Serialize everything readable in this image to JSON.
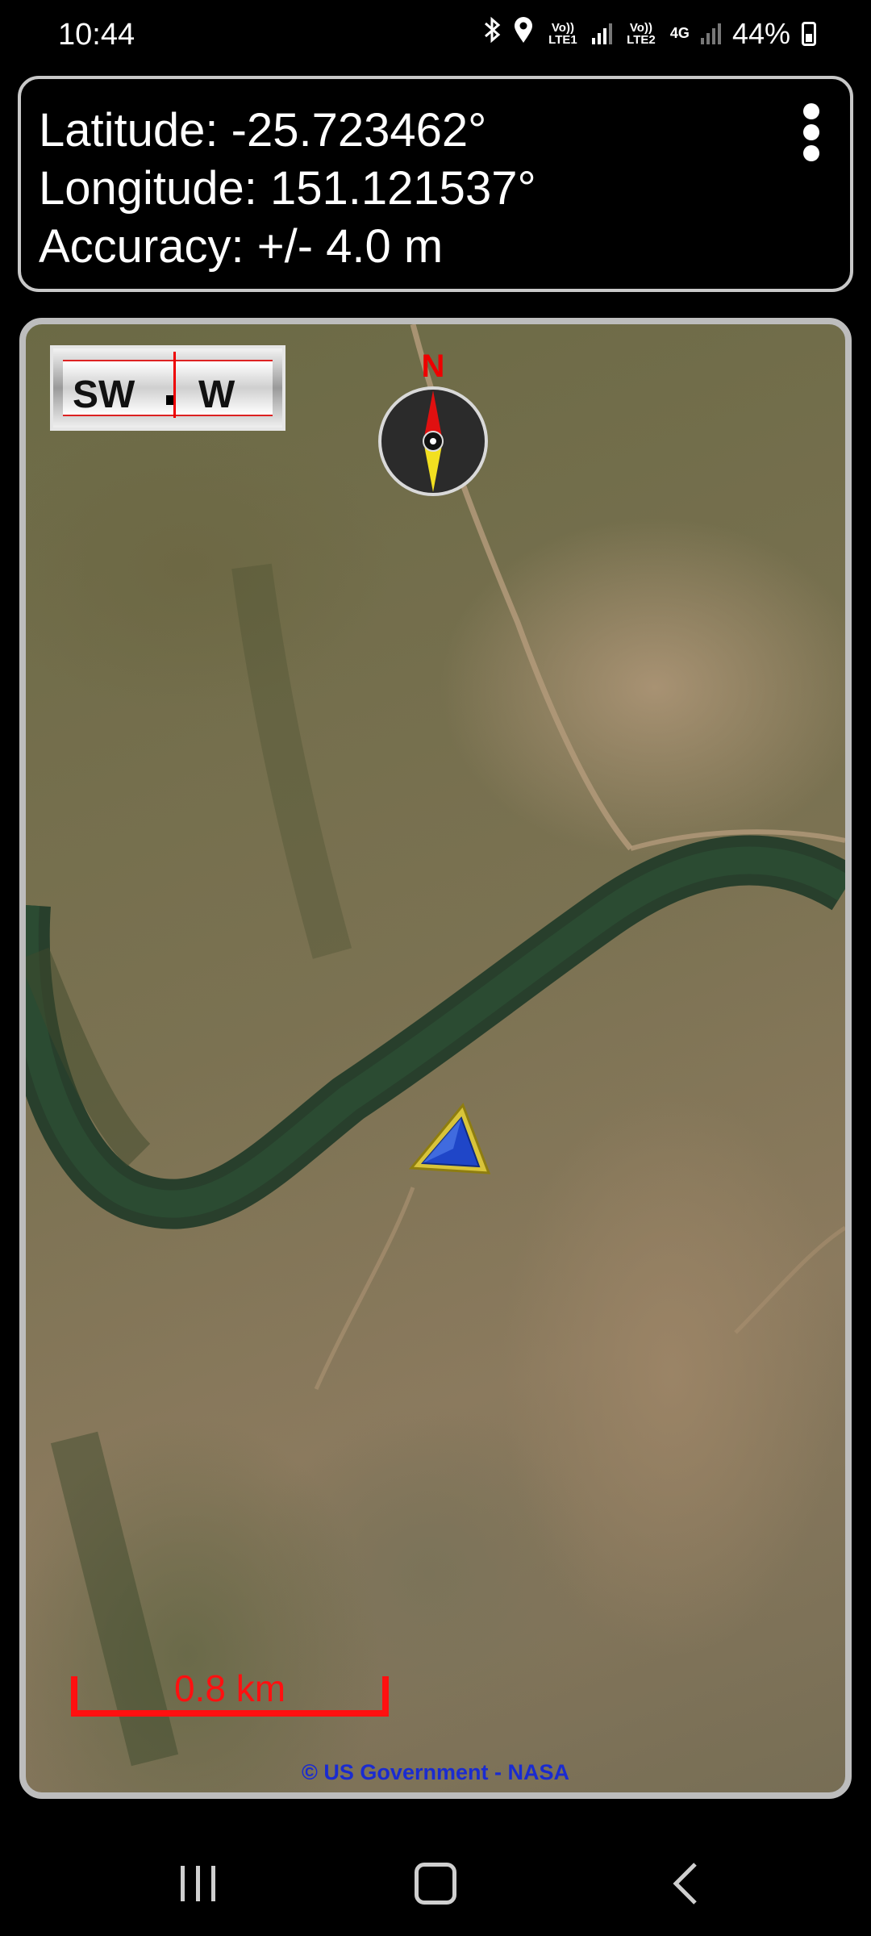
{
  "status_bar": {
    "time": "10:44",
    "icons": [
      "bluetooth-icon",
      "location-icon",
      "signal-sim1-icon",
      "signal-sim2-icon",
      "battery-charging-icon"
    ],
    "sim1_label": "Vo)) LTE1",
    "sim2_label": "Vo)) LTE2",
    "sim2_tech": "4G",
    "battery_percent": "44%"
  },
  "location": {
    "latitude": "Latitude: -25.723462°",
    "longitude": "Longitude:  151.121537°",
    "accuracy": "Accuracy:  +/- 4.0 m",
    "menu_icon": "more-vert-icon"
  },
  "map": {
    "heading_left": "SW",
    "heading_right": "W",
    "compass_north": "N",
    "scale": "0.8 km",
    "attribution": "© US Government - NASA",
    "colors": {
      "scale": "#ff1010",
      "attribution": "#1a2bd0",
      "position_marker": "#1f46c8",
      "marker_border": "#d8c43a"
    }
  },
  "nav_bar": {
    "buttons": [
      "recents-icon",
      "home-icon",
      "back-icon"
    ]
  }
}
